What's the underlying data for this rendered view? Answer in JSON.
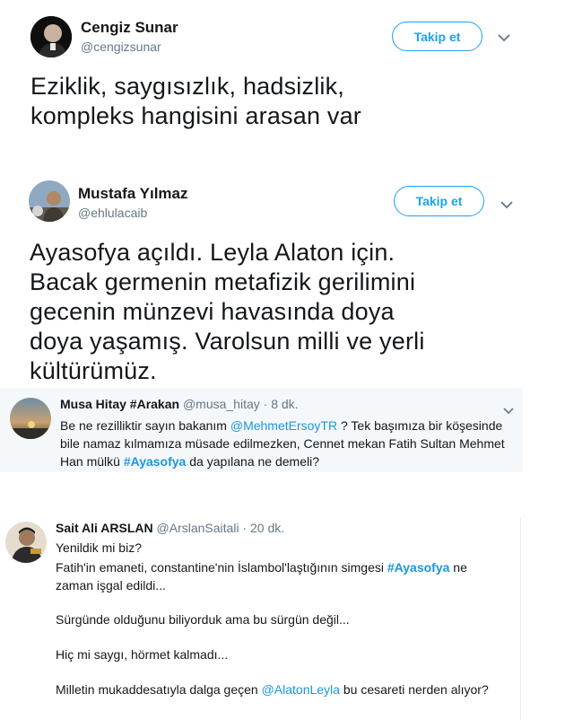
{
  "tweet1": {
    "name": "Cengiz Sunar",
    "handle": "@cengizsunar",
    "follow_label": "Takip et",
    "text": "Eziklik, saygısızlık, hadsizlik, kompleks hangisini arasan var"
  },
  "tweet2": {
    "name": "Mustafa Yılmaz",
    "handle": "@ehlulacaib",
    "follow_label": "Takip et",
    "text": "Ayasofya açıldı. Leyla Alaton için. Bacak germenin metafizik gerilimini gecenin münzevi havasında doya doya yaşamış. Varolsun milli ve yerli kültürümüz."
  },
  "tweet3": {
    "name": "Musa Hitay #Arakan",
    "handle": "@musa_hitay",
    "time": "· 8 dk.",
    "text_a": "Be ne rezilliktir sayın bakanım ",
    "mention": "@MehmetErsoyTR",
    "text_b": " ? Tek başımıza bir köşesinde bile namaz kılmamıza müsade edilmezken, Cennet mekan Fatih Sultan Mehmet Han mülkü ",
    "hashtag": "#Ayasofya",
    "text_c": " da yapılana ne demeli?"
  },
  "tweet4": {
    "name": "Sait Ali ARSLAN",
    "handle": "@ArslanSaitali",
    "time": "· 20 dk.",
    "line1": "Yenildik mi biz?",
    "line2_a": "Fatih'in emaneti, constantine'nin İslambol'laştığının simgesi ",
    "hashtag": "#Ayasofya",
    "line2_b": " ne zaman işgal edildi...",
    "line3": "Sürgünde olduğunu biliyorduk ama bu sürgün değil...",
    "line4": "Hiç mi saygı, hörmet kalmadı...",
    "line5_a": "Milletin mukaddesatıyla dalga geçen ",
    "mention": "@AlatonLeyla",
    "line5_b": " bu cesareti nerden alıyor?"
  },
  "colors": {
    "accent": "#1da1f2",
    "link": "#1b95e0",
    "secondary_text": "#657786",
    "quoted_bg": "#f5f8fa"
  }
}
